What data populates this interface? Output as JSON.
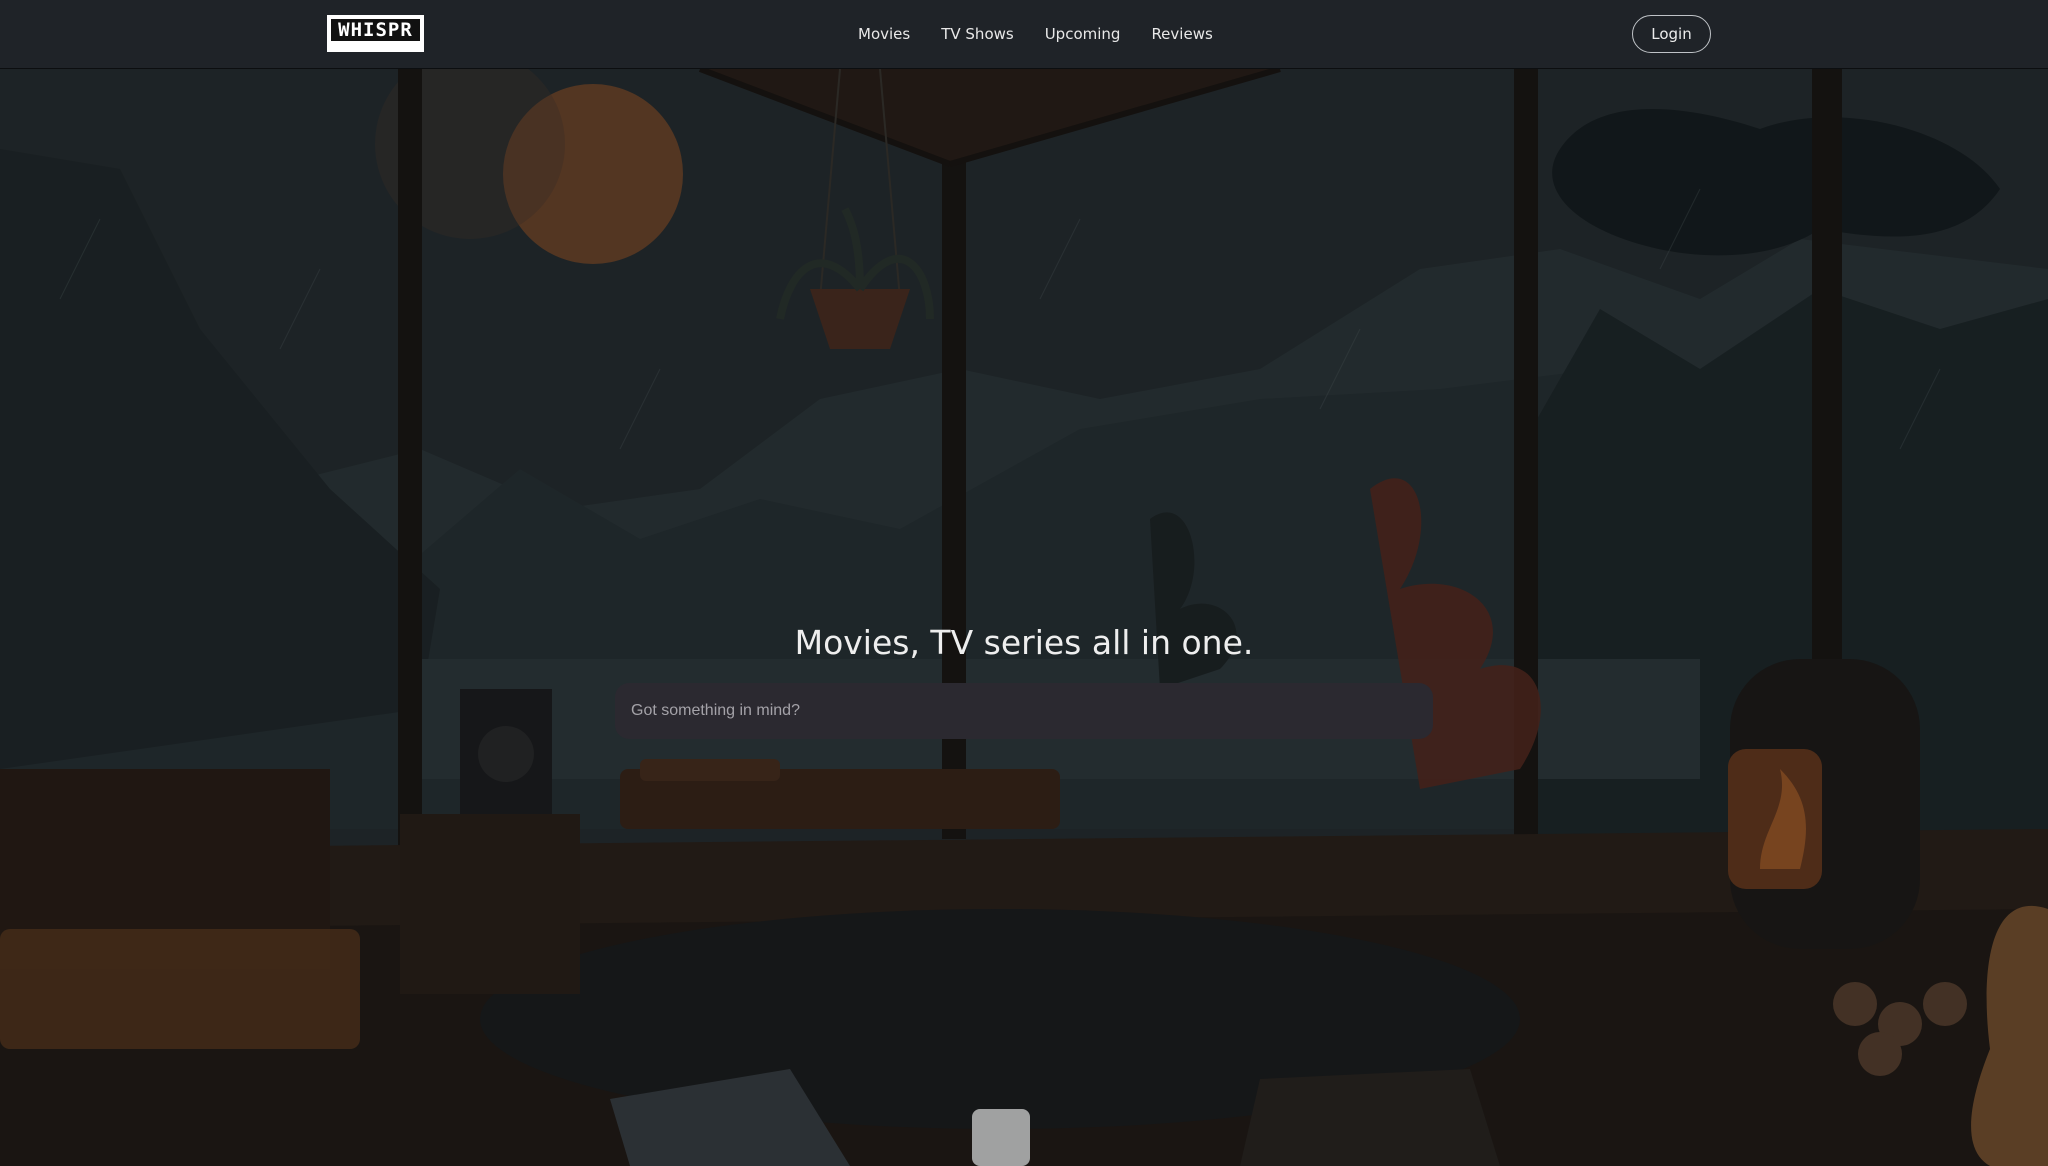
{
  "navbar": {
    "logo_text": "WHISPR",
    "links": [
      "Movies",
      "TV Shows",
      "Upcoming",
      "Reviews"
    ],
    "login_label": "Login"
  },
  "hero": {
    "headline": "Movies, TV series all in one.",
    "search_placeholder": "Got something in mind?"
  },
  "colors": {
    "navbar_bg": "#1f2328",
    "search_bg": "#2b2930",
    "accent_orange": "#b86a2a"
  }
}
